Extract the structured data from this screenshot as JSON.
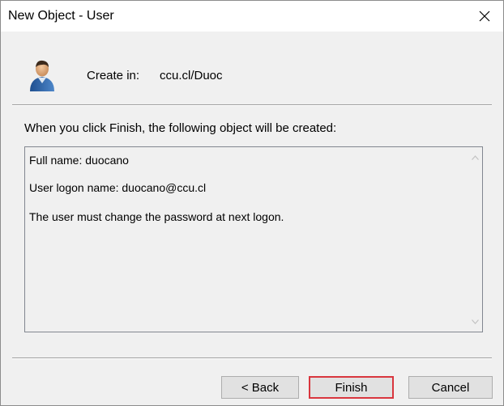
{
  "window": {
    "title": "New Object - User"
  },
  "header": {
    "create_in_label": "Create in:",
    "create_in_value": "ccu.cl/Duoc"
  },
  "body": {
    "intro": "When you click Finish, the following object will be created:",
    "summary_lines": [
      "Full name: duocano",
      "User logon name: duocano@ccu.cl",
      "The user must change the password at next logon."
    ]
  },
  "buttons": {
    "back": "< Back",
    "finish": "Finish",
    "cancel": "Cancel"
  },
  "colors": {
    "highlight": "#d9363e",
    "dialog_bg": "#f0f0f0",
    "titlebar_bg": "#ffffff"
  },
  "icons": {
    "close": "close-icon",
    "user": "user-icon",
    "scroll_up": "scroll-up-arrow-icon",
    "scroll_down": "scroll-down-arrow-icon"
  }
}
